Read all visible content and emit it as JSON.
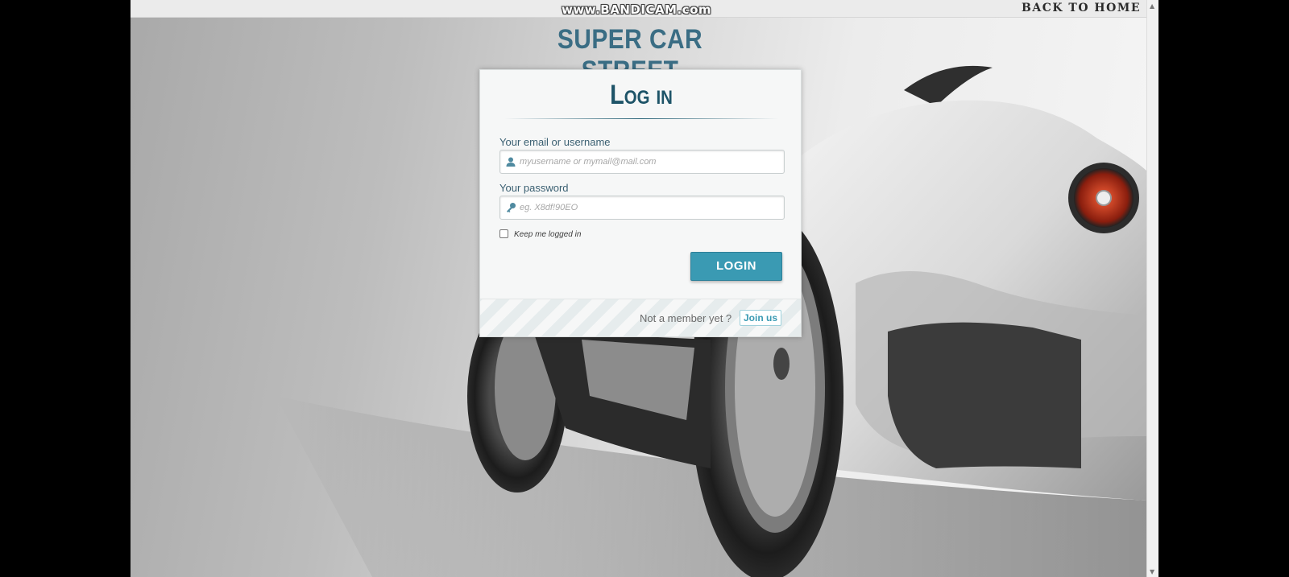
{
  "watermark": "www.BANDICAM.com",
  "header": {
    "back_home": "BACK TO HOME"
  },
  "site": {
    "title": "SUPER CAR STREET"
  },
  "login": {
    "heading": "Log in",
    "username_label": "Your email or username",
    "username_placeholder": "myusername or mymail@mail.com",
    "username_value": "",
    "password_label": "Your password",
    "password_placeholder": "eg. X8df!90EO",
    "password_value": "",
    "keep_logged_label": "Keep me logged in",
    "keep_logged_checked": false,
    "submit_label": "LOGIN",
    "not_member_text": "Not a member yet ?",
    "join_label": "Join us"
  },
  "colors": {
    "accent": "#3a9ab3",
    "title": "#3a6d84",
    "heading": "#1e5468"
  },
  "icons": {
    "username": "user-icon",
    "password": "key-icon"
  }
}
